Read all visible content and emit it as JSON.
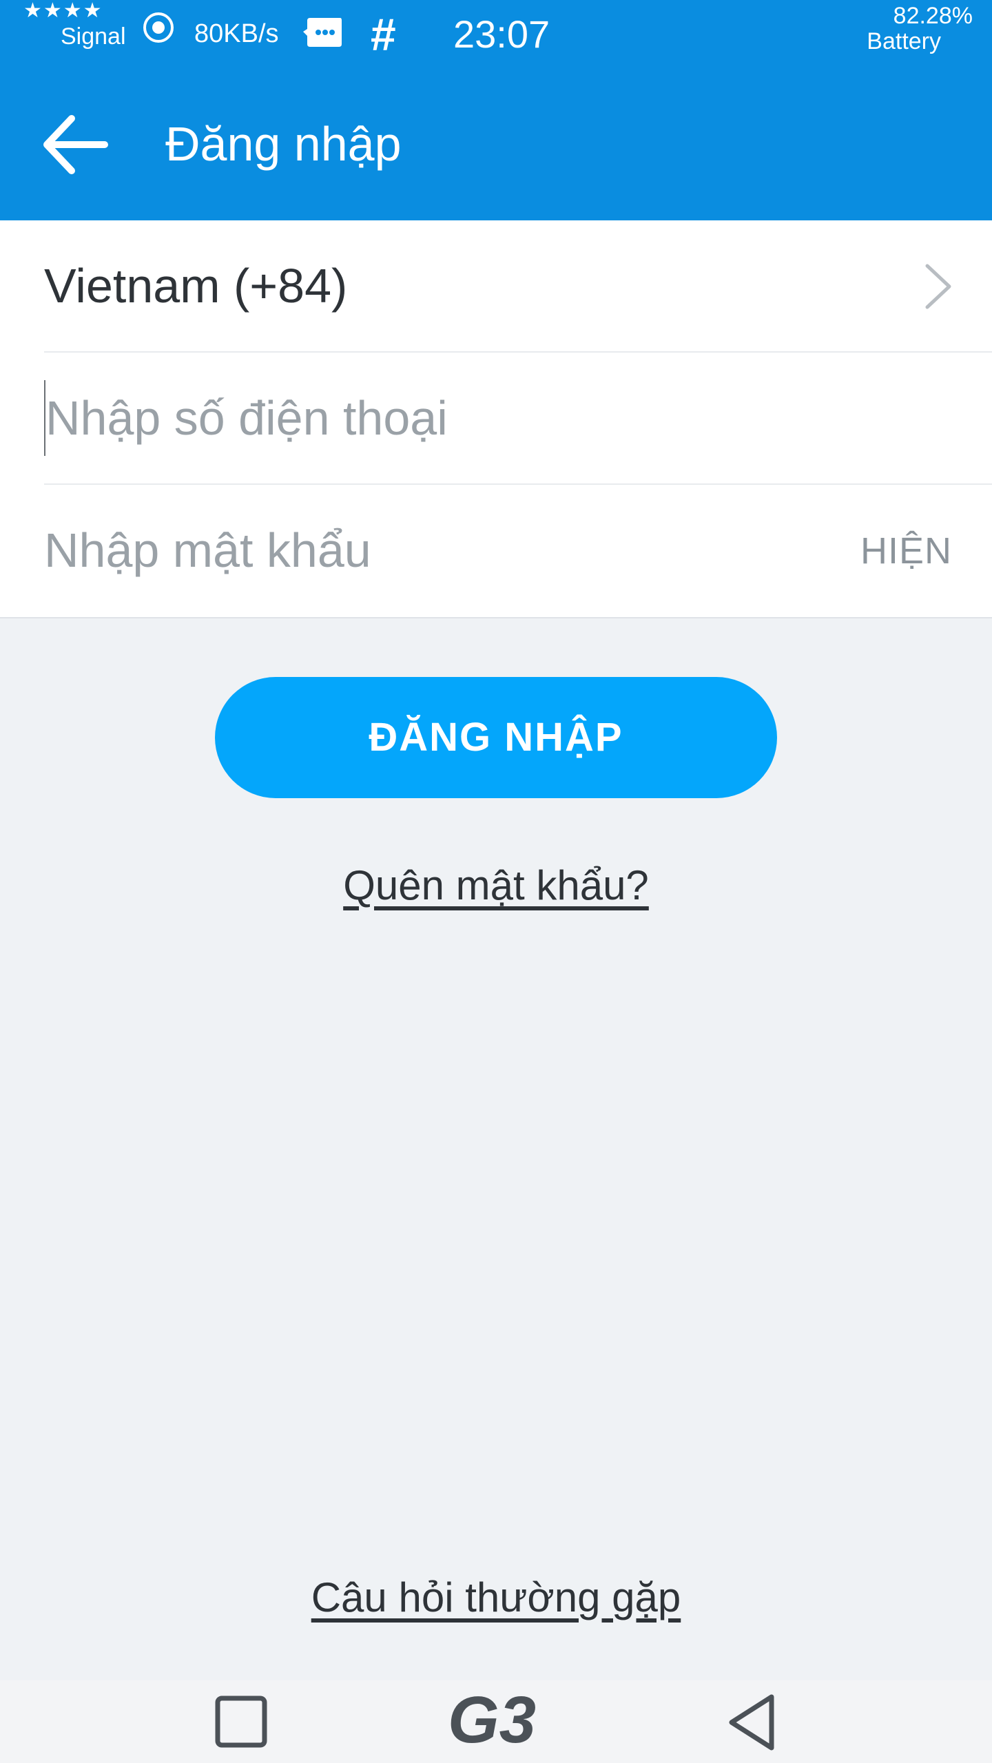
{
  "status_bar": {
    "stars": "★★★★",
    "signal_label": "Signal",
    "net_speed": "80KB/s",
    "hash_symbol": "#",
    "time": "23:07",
    "battery_percent": "82.28%",
    "battery_label": "Battery",
    "icons": [
      "hotspot-icon",
      "message-icon"
    ]
  },
  "app_bar": {
    "back_icon": "arrow-left-icon",
    "title": "Đăng nhập"
  },
  "form": {
    "country": {
      "label": "Vietnam (+84)",
      "icon": "chevron-right-icon"
    },
    "phone": {
      "value": "",
      "placeholder": "Nhập số điện thoại"
    },
    "password": {
      "value": "",
      "placeholder": "Nhập mật khẩu",
      "toggle_label": "HIỆN"
    }
  },
  "login_button": {
    "label": "ĐĂNG NHẬP"
  },
  "forgot_password_link": "Quên mật khẩu?",
  "faq_link": "Câu hỏi thường gặp",
  "nav_bar": {
    "icons": [
      "recents-square-icon",
      "home-logo-icon",
      "back-triangle-icon"
    ],
    "home_logo_text": "G3"
  },
  "colors": {
    "primary": "#0a8de0",
    "button": "#04a6fb",
    "background": "#eff2f5",
    "text": "#2e3338",
    "placeholder": "#9aa1a7"
  }
}
